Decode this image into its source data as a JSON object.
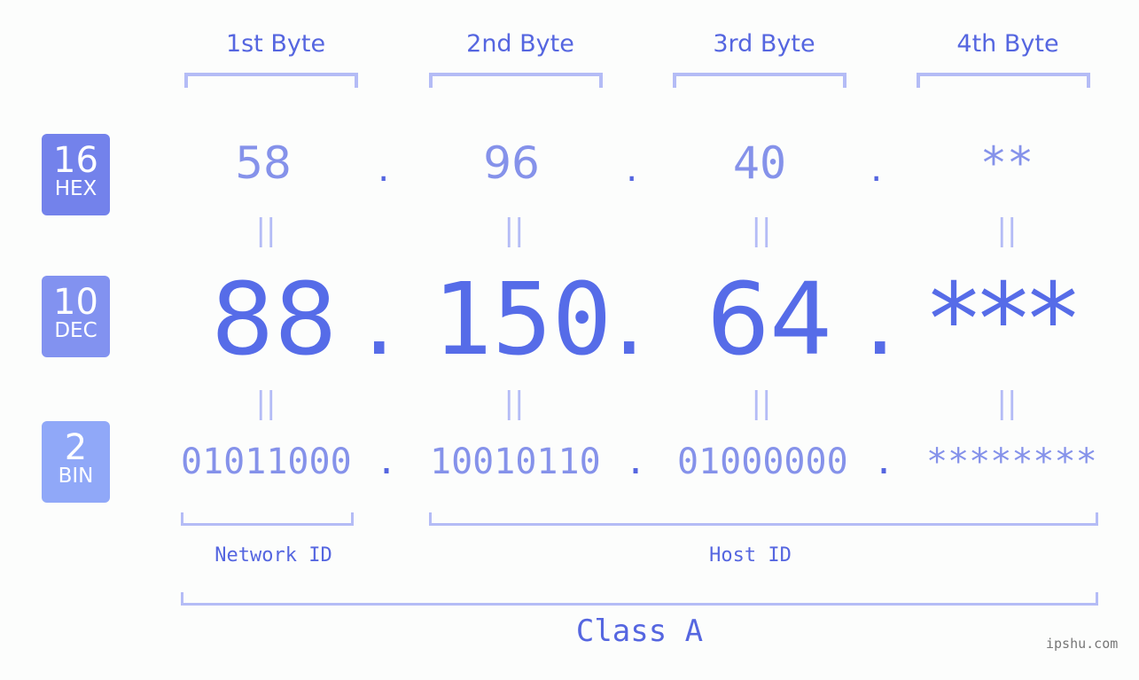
{
  "headers": [
    "1st Byte",
    "2nd Byte",
    "3rd Byte",
    "4th Byte"
  ],
  "badges": {
    "hex": {
      "num": "16",
      "label": "HEX",
      "color": "#7382eb"
    },
    "dec": {
      "num": "10",
      "label": "DEC",
      "color": "#8292f0"
    },
    "bin": {
      "num": "2",
      "label": "BIN",
      "color": "#90a8f8"
    }
  },
  "hex": [
    "58",
    "96",
    "40",
    "**"
  ],
  "dec": [
    "88",
    "150",
    "64",
    "***"
  ],
  "bin": [
    "01011000",
    "10010110",
    "01000000",
    "********"
  ],
  "separator": ".",
  "equals": "||",
  "network_id_label": "Network ID",
  "host_id_label": "Host ID",
  "class_label": "Class A",
  "watermark": "ipshu.com",
  "colors": {
    "accent": "#566ce8",
    "light": "#8592ea",
    "bracket": "#b4bcf6"
  }
}
